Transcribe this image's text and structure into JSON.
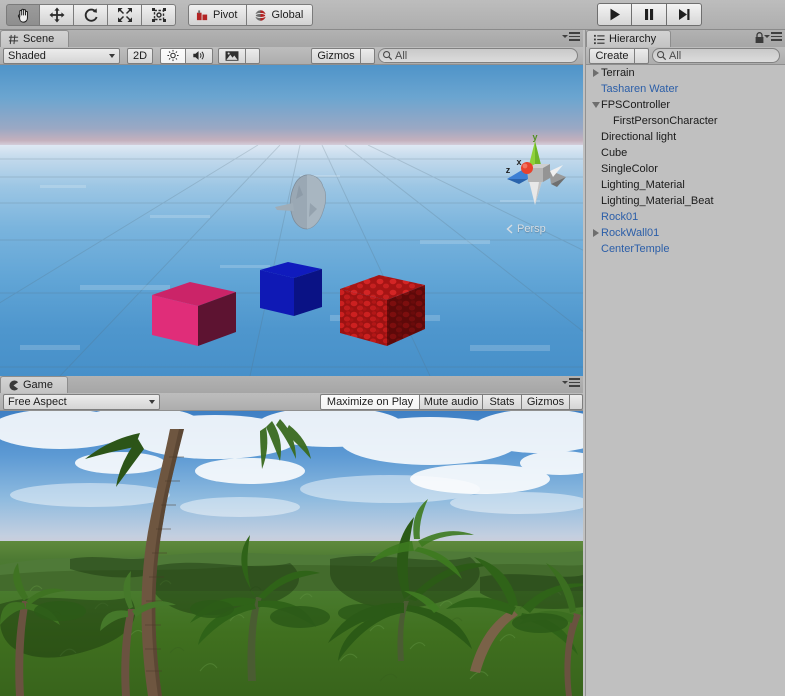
{
  "app": {
    "title": "Unity Editor"
  },
  "toolbar": {
    "tools": [
      {
        "name": "hand-tool",
        "icon": "hand-icon",
        "active": true
      },
      {
        "name": "move-tool",
        "icon": "move-arrows-icon",
        "active": false
      },
      {
        "name": "rotate-tool",
        "icon": "rotate-icon",
        "active": false
      },
      {
        "name": "scale-tool",
        "icon": "scale-icon",
        "active": false
      },
      {
        "name": "rect-tool",
        "icon": "rect-transform-icon",
        "active": false
      }
    ],
    "pivot_label": "Pivot",
    "pivot_icon": "pivot-icon",
    "global_label": "Global",
    "global_icon": "globe-icon",
    "play_label": "play-icon",
    "pause_label": "pause-icon",
    "step_label": "step-icon"
  },
  "scene_panel": {
    "tab_label": "Scene",
    "tab_icon": "scene-grid-icon",
    "draw_mode": "Shaded",
    "twod_label": "2D",
    "lighting_icon": "sun-icon",
    "audio_icon": "speaker-icon",
    "effects_icon": "image-icon",
    "gizmos_label": "Gizmos",
    "search_placeholder": "All",
    "search_value": "",
    "search_icon": "search-icon",
    "menu_icon": "hamburger-icon",
    "view_gizmo": {
      "axis_y": "y",
      "axis_x": "x",
      "axis_z": "z",
      "projection": "Persp"
    },
    "objects": [
      {
        "name": "pink-cube",
        "color": "#d6256f",
        "side_color": "#5e1330",
        "top_color": "#c42365"
      },
      {
        "name": "blue-cube",
        "color": "#0d17ad",
        "side_color": "#0a1287",
        "top_color": "#131ec2"
      },
      {
        "name": "red-rock-cube",
        "color": "#a81010",
        "side_color": "#6e0a0a",
        "top_color": "#b81515"
      },
      {
        "name": "rock-formation",
        "color": "#93a3b0"
      }
    ]
  },
  "game_panel": {
    "tab_label": "Game",
    "tab_icon": "game-pacman-icon",
    "aspect": "Free Aspect",
    "maximize_label": "Maximize on Play",
    "mute_label": "Mute audio",
    "stats_label": "Stats",
    "gizmos_label": "Gizmos",
    "menu_icon": "hamburger-icon",
    "scene_description": "tropical-jungle-terrain-with-palm-trees"
  },
  "hierarchy": {
    "tab_label": "Hierarchy",
    "tab_icon": "hierarchy-list-icon",
    "lock_icon": "lock-icon",
    "menu_icon": "hamburger-icon",
    "create_label": "Create",
    "search_placeholder": "All",
    "search_value": "",
    "search_icon": "search-icon",
    "items": [
      {
        "label": "Terrain",
        "indent": 0,
        "foldout": "collapsed",
        "prefab": false
      },
      {
        "label": "Tasharen Water",
        "indent": 1,
        "foldout": "none",
        "prefab": true
      },
      {
        "label": "FPSController",
        "indent": 0,
        "foldout": "expanded",
        "prefab": false
      },
      {
        "label": "FirstPersonCharacter",
        "indent": 2,
        "foldout": "none",
        "prefab": false
      },
      {
        "label": "Directional light",
        "indent": 1,
        "foldout": "none",
        "prefab": false
      },
      {
        "label": "Cube",
        "indent": 1,
        "foldout": "none",
        "prefab": false
      },
      {
        "label": "SingleColor",
        "indent": 1,
        "foldout": "none",
        "prefab": false
      },
      {
        "label": "Lighting_Material",
        "indent": 1,
        "foldout": "none",
        "prefab": false
      },
      {
        "label": "Lighting_Material_Beat",
        "indent": 1,
        "foldout": "none",
        "prefab": false
      },
      {
        "label": "Rock01",
        "indent": 1,
        "foldout": "none",
        "prefab": true
      },
      {
        "label": "RockWall01",
        "indent": 0,
        "foldout": "collapsed",
        "prefab": true
      },
      {
        "label": "CenterTemple",
        "indent": 1,
        "foldout": "none",
        "prefab": true
      }
    ]
  },
  "colors": {
    "chrome": "#c0c0c0",
    "toolbar": "#b4b4b4",
    "prefab_blue": "#2b5ea8",
    "text": "#1a1a1a"
  }
}
